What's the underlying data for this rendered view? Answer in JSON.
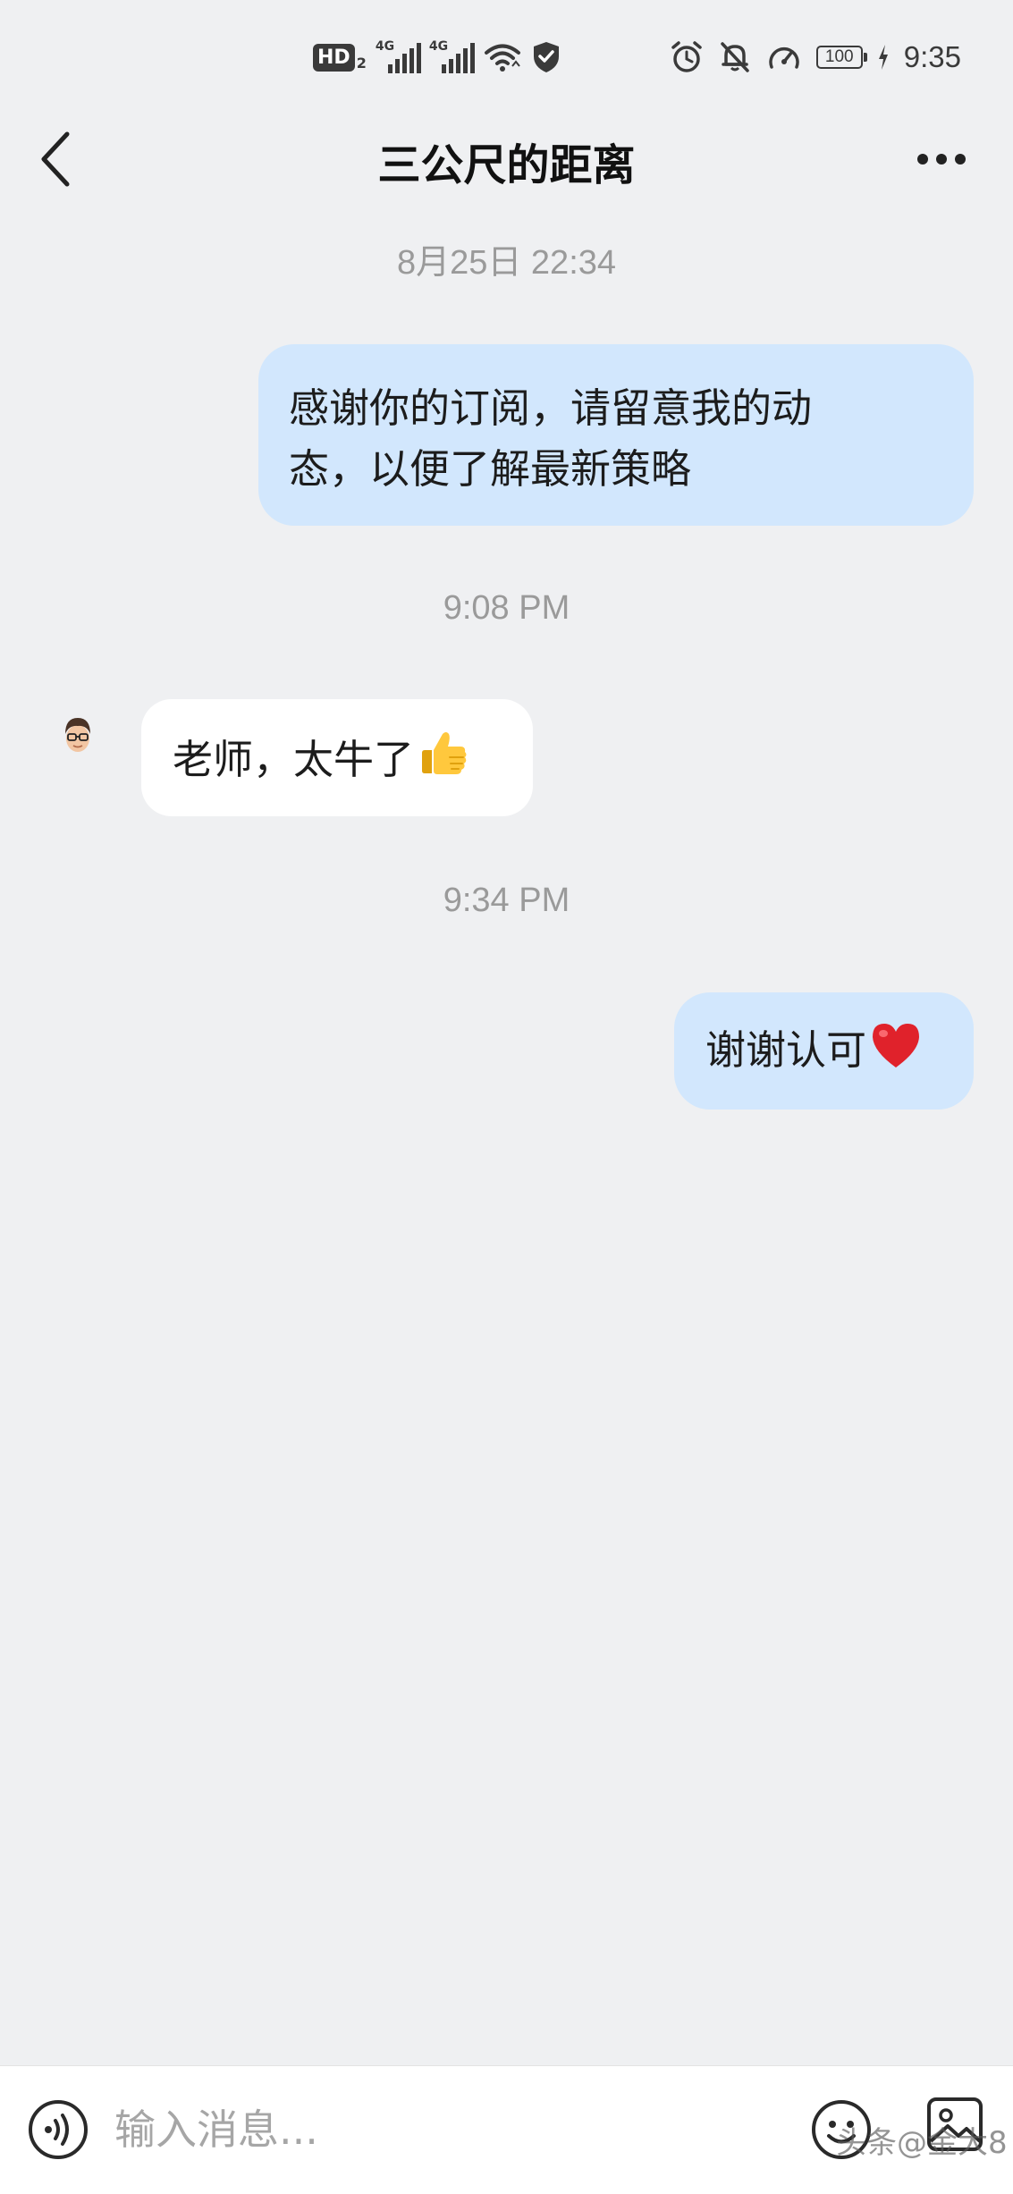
{
  "status_bar": {
    "hd_label": "HD",
    "hd_sim": "2",
    "signal_label_1": "4G",
    "signal_label_2": "4G",
    "battery": "100",
    "time": "9:35",
    "icons": [
      "hd-icon",
      "signal-icon",
      "signal-icon",
      "wifi-icon",
      "shield-icon",
      "alarm-icon",
      "bell-off-icon",
      "speed-icon",
      "battery-icon",
      "charging-icon"
    ]
  },
  "header": {
    "title": "三公尺的距离",
    "back_icon": "chevron-left-icon",
    "more_icon": "more-dots-icon"
  },
  "conversation": {
    "messages": [
      {
        "type": "timestamp",
        "text": "8月25日 22:34"
      },
      {
        "type": "outgoing",
        "lines": [
          "感谢你的订阅，请留意我的动",
          "态，以便了解最新策略"
        ]
      },
      {
        "type": "timestamp",
        "text": "9:08 PM"
      },
      {
        "type": "incoming",
        "text": "老师，太牛了",
        "emoji": "thumbs-up-emoji",
        "avatar": "memoji-avatar"
      },
      {
        "type": "timestamp",
        "text": "9:34 PM"
      },
      {
        "type": "outgoing",
        "text": "谢谢认可",
        "emoji": "red-heart-emoji"
      }
    ]
  },
  "input_bar": {
    "placeholder": "输入消息...",
    "value": "",
    "voice_icon": "voice-icon",
    "emoji_icon": "emoji-icon",
    "image_icon": "image-icon",
    "watermark": "头条@金大8"
  },
  "colors": {
    "background": "#eff0f2",
    "outgoing_bubble": "#d2e7fd",
    "incoming_bubble": "#ffffff",
    "timestamp_text": "#9a9a9a"
  }
}
